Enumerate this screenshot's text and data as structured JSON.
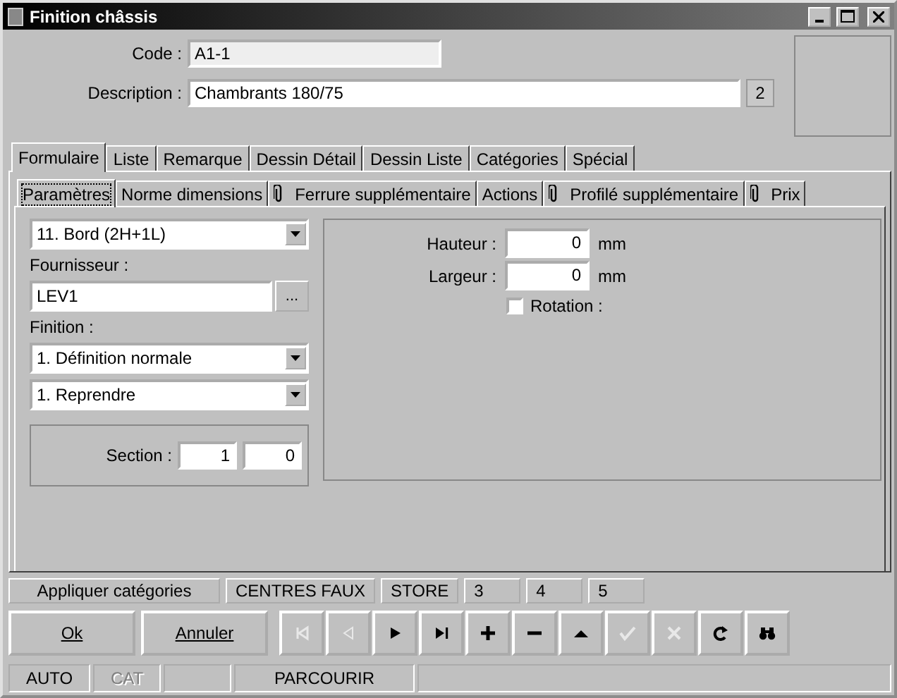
{
  "window": {
    "title": "Finition châssis"
  },
  "header": {
    "code": {
      "label": "Code :",
      "value": "A1-1"
    },
    "description": {
      "label": "Description :",
      "value": "Chambrants 180/75"
    },
    "count": "2"
  },
  "tabs": [
    {
      "label": "Formulaire",
      "selected": true
    },
    {
      "label": "Liste",
      "selected": false
    },
    {
      "label": "Remarque",
      "selected": false
    },
    {
      "label": "Dessin Détail",
      "selected": false
    },
    {
      "label": "Dessin Liste",
      "selected": false
    },
    {
      "label": "Catégories",
      "selected": false
    },
    {
      "label": "Spécial",
      "selected": false
    }
  ],
  "subtabs": [
    {
      "label": "Paramètres",
      "selected": true,
      "attachment": false
    },
    {
      "label": "Norme dimensions",
      "selected": false,
      "attachment": false
    },
    {
      "label": "Ferrure supplémentaire",
      "selected": false,
      "attachment": true
    },
    {
      "label": "Actions",
      "selected": false,
      "attachment": false
    },
    {
      "label": "Profilé supplémentaire",
      "selected": false,
      "attachment": true
    },
    {
      "label": "Prix",
      "selected": false,
      "attachment": true
    }
  ],
  "left": {
    "type_select": "11. Bord (2H+1L)",
    "supplier_label": "Fournisseur :",
    "supplier": "LEV1",
    "browse": "...",
    "finish_label": "Finition :",
    "finish_select": "1. Définition normale",
    "mode_select": "1. Reprendre",
    "section_label": "Section :",
    "section_values": [
      "1",
      "0"
    ]
  },
  "right": {
    "fields": [
      {
        "label": "Hauteur :",
        "value": "0",
        "unit": "mm"
      },
      {
        "label": "Largeur :",
        "value": "0",
        "unit": "mm"
      }
    ],
    "rotation": {
      "label": "Rotation :",
      "checked": false
    }
  },
  "category_buttons": [
    "Appliquer catégories",
    "CENTRES FAUX",
    "STORE",
    "3",
    "4",
    "5"
  ],
  "actions": [
    {
      "label": "Ok"
    },
    {
      "label": "Annuler"
    }
  ],
  "nav": [
    {
      "kind": "first",
      "disabled": true
    },
    {
      "kind": "prev",
      "disabled": true
    },
    {
      "kind": "next",
      "disabled": false
    },
    {
      "kind": "last",
      "disabled": false
    },
    {
      "kind": "add",
      "disabled": false
    },
    {
      "kind": "remove",
      "disabled": false
    },
    {
      "kind": "up",
      "disabled": false
    },
    {
      "kind": "confirm",
      "disabled": true
    },
    {
      "kind": "cancel",
      "disabled": true
    },
    {
      "kind": "refresh",
      "disabled": false
    },
    {
      "kind": "search",
      "disabled": false
    }
  ],
  "status_bar": [
    {
      "text": "AUTO",
      "disabled": false
    },
    {
      "text": "CAT",
      "disabled": true
    },
    {
      "text": "PARCOURIR",
      "disabled": false
    }
  ]
}
